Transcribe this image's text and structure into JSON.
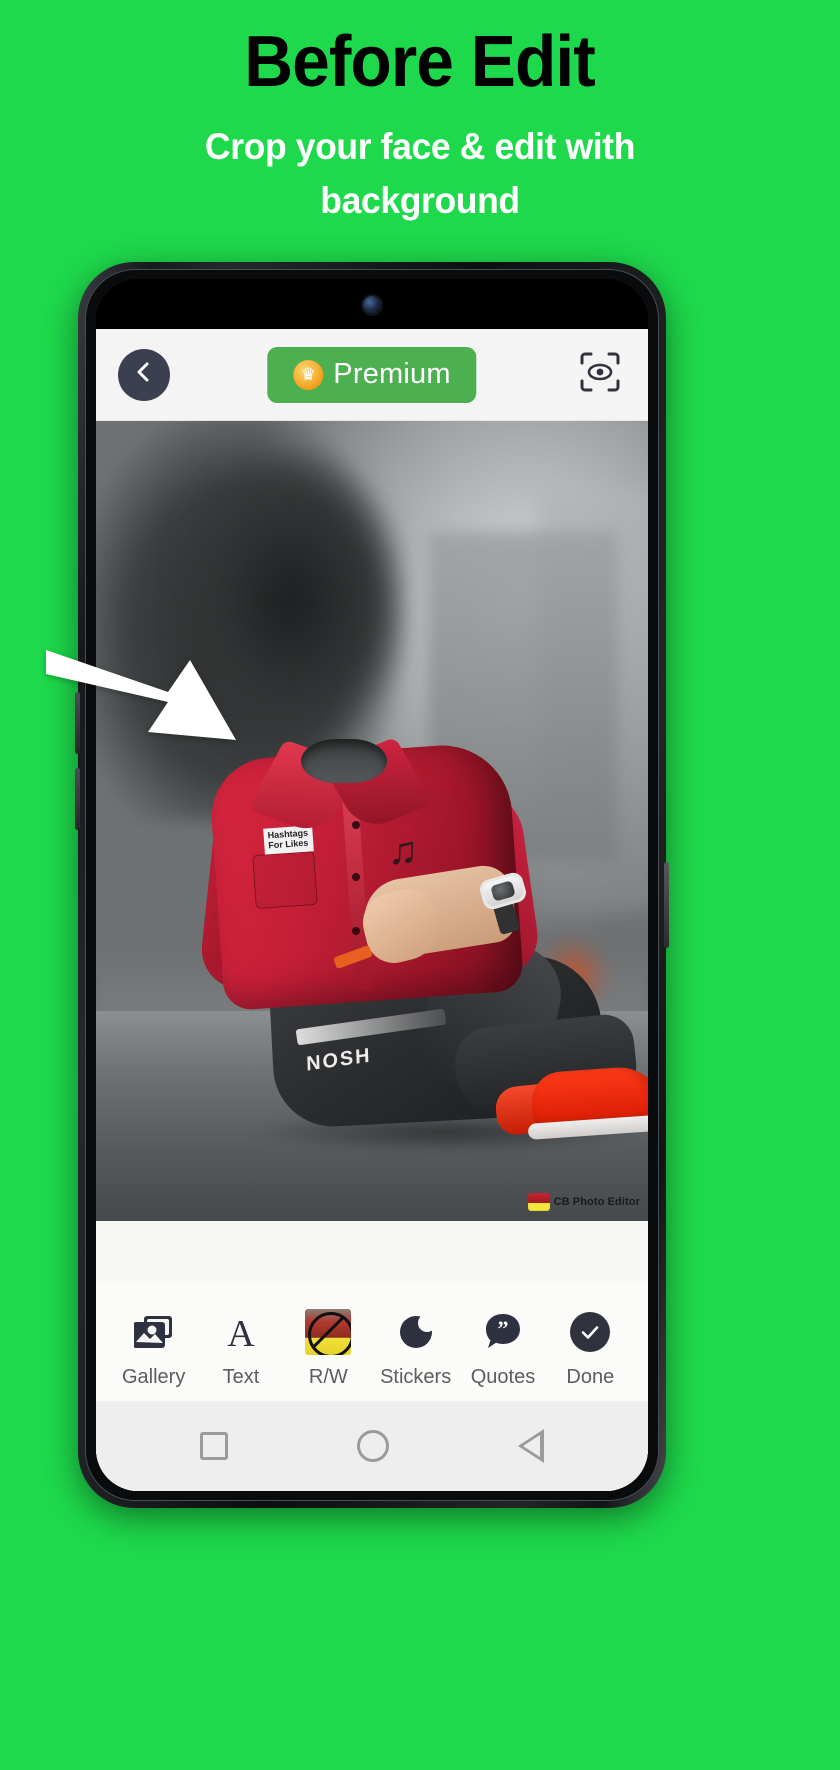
{
  "promo": {
    "title": "Before Edit",
    "subtitle": "Crop your face & edit with background",
    "background_color": "#1ed94b",
    "title_color": "#000000",
    "subtitle_color": "#ffffff"
  },
  "phone": {
    "device_frame_color": "#16181b",
    "screen_background": "#000000"
  },
  "app": {
    "appbar": {
      "back_icon": "chevron-left-icon",
      "premium_label": "Premium",
      "premium_icon": "crown-icon",
      "premium_color": "#4caf50",
      "right_icon": "face-scan-icon"
    },
    "canvas": {
      "watermark_text": "CB Photo Editor",
      "watermark_icon": "cb-photo-editor-logo-icon",
      "shirt_tag_line1": "Hashtags",
      "shirt_tag_line2": "For Likes",
      "jeans_text": "NOSH",
      "overlay_logo": "tiktok-icon"
    },
    "toolbar": [
      {
        "label": "Gallery",
        "icon": "gallery-icon"
      },
      {
        "label": "Text",
        "icon": "text-a-icon"
      },
      {
        "label": "R/W",
        "icon": "black-and-white-thumb-icon"
      },
      {
        "label": "Stickers",
        "icon": "moon-sticker-icon"
      },
      {
        "label": "Quotes",
        "icon": "quote-bubble-icon"
      },
      {
        "label": "Done",
        "icon": "check-circle-icon"
      }
    ],
    "navbar": [
      {
        "name": "recents",
        "icon": "square-icon"
      },
      {
        "name": "home",
        "icon": "circle-icon"
      },
      {
        "name": "back",
        "icon": "triangle-back-icon"
      }
    ]
  },
  "annotation": {
    "arrow": "white-arrow-pointing-down-right",
    "arrow_color": "#ffffff"
  }
}
